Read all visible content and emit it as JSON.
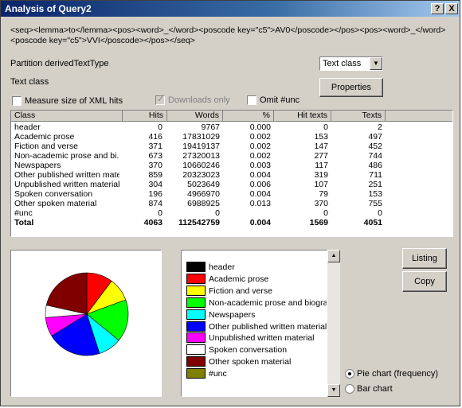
{
  "window": {
    "title": "Analysis of Query2",
    "help_label": "?",
    "close_label": "X"
  },
  "query_text": "<seq><lemma>to</lemma><pos><word>_</word><poscode key=\"c5\">AV0</poscode></pos><pos><word>_</word><poscode key=\"c5\">VVI</poscode></pos></seq>",
  "partition_label": "Partition derivedTextType",
  "text_class_label": "Text class",
  "partition_select": {
    "value": "Text class"
  },
  "properties_button": "Properties",
  "checkboxes": {
    "measure_size": {
      "label": "Measure size of XML hits",
      "checked": false
    },
    "downloads_only": {
      "label": "Downloads only",
      "checked": true,
      "disabled": true
    },
    "omit_unc": {
      "label": "Omit #unc",
      "checked": false
    }
  },
  "table": {
    "headers": [
      "Class",
      "Hits",
      "Words",
      "%",
      "Hit texts",
      "Texts"
    ],
    "rows": [
      [
        "header",
        "0",
        "9767",
        "0.000",
        "0",
        "2"
      ],
      [
        "Academic prose",
        "416",
        "17831029",
        "0.002",
        "153",
        "497"
      ],
      [
        "Fiction and verse",
        "371",
        "19419137",
        "0.002",
        "147",
        "452"
      ],
      [
        "Non-academic prose and bi...",
        "673",
        "27320013",
        "0.002",
        "277",
        "744"
      ],
      [
        "Newspapers",
        "370",
        "10660246",
        "0.003",
        "117",
        "486"
      ],
      [
        "Other published written mate...",
        "859",
        "20323023",
        "0.004",
        "319",
        "711"
      ],
      [
        "Unpublished written material",
        "304",
        "5023649",
        "0.006",
        "107",
        "251"
      ],
      [
        "Spoken conversation",
        "196",
        "4966970",
        "0.004",
        "79",
        "153"
      ],
      [
        "Other spoken material",
        "874",
        "6988925",
        "0.013",
        "370",
        "755"
      ],
      [
        "#unc",
        "0",
        "0",
        "",
        "0",
        "0"
      ]
    ],
    "total": [
      "Total",
      "4063",
      "112542759",
      "0.004",
      "1569",
      "4051"
    ]
  },
  "buttons": {
    "listing": "Listing",
    "copy": "Copy"
  },
  "legend": [
    {
      "label": "header",
      "color": "#000000"
    },
    {
      "label": "Academic prose",
      "color": "#ff0000"
    },
    {
      "label": "Fiction and verse",
      "color": "#ffff00"
    },
    {
      "label": "Non-academic prose and biography",
      "color": "#00ff00"
    },
    {
      "label": "Newspapers",
      "color": "#00ffff"
    },
    {
      "label": "Other published written material",
      "color": "#0000ff"
    },
    {
      "label": "Unpublished written material",
      "color": "#ff00ff"
    },
    {
      "label": "Spoken conversation",
      "color": "#ffffff"
    },
    {
      "label": "Other spoken material",
      "color": "#800000"
    },
    {
      "label": "#unc",
      "color": "#808000"
    }
  ],
  "chart_options": [
    {
      "label": "Pie chart (frequency)",
      "selected": true
    },
    {
      "label": "Bar chart",
      "selected": false
    }
  ],
  "chart_data": {
    "type": "pie",
    "categories": [
      "header",
      "Academic prose",
      "Fiction and verse",
      "Non-academic prose and biography",
      "Newspapers",
      "Other published written material",
      "Unpublished written material",
      "Spoken conversation",
      "Other spoken material",
      "#unc"
    ],
    "values": [
      0,
      416,
      371,
      673,
      370,
      859,
      304,
      196,
      874,
      0
    ],
    "colors": [
      "#000000",
      "#ff0000",
      "#ffff00",
      "#00ff00",
      "#00ffff",
      "#0000ff",
      "#ff00ff",
      "#ffffff",
      "#800000",
      "#808000"
    ]
  }
}
